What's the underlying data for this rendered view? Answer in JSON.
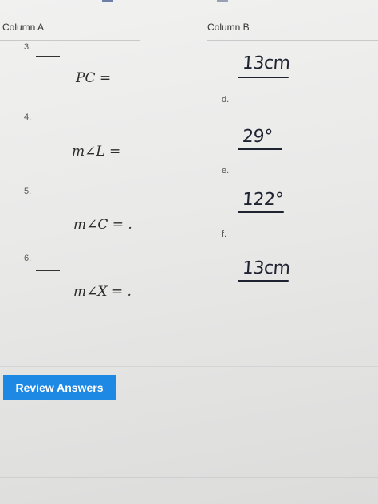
{
  "header": {
    "column_a": "Column A",
    "column_b": "Column B"
  },
  "questions": [
    {
      "number": "3.",
      "expression": "PC =",
      "letter": "d.",
      "answer": "13cm"
    },
    {
      "number": "4.",
      "expression": "m∠L =",
      "letter": "e.",
      "answer": "29°"
    },
    {
      "number": "5.",
      "expression": "m∠C = .",
      "letter": "f.",
      "answer": "122°"
    },
    {
      "number": "6.",
      "expression": "m∠X = .",
      "letter": "",
      "answer": "13cm"
    }
  ],
  "footer": {
    "review_label": "Review Answers",
    "button_color": "#1e88e5"
  }
}
